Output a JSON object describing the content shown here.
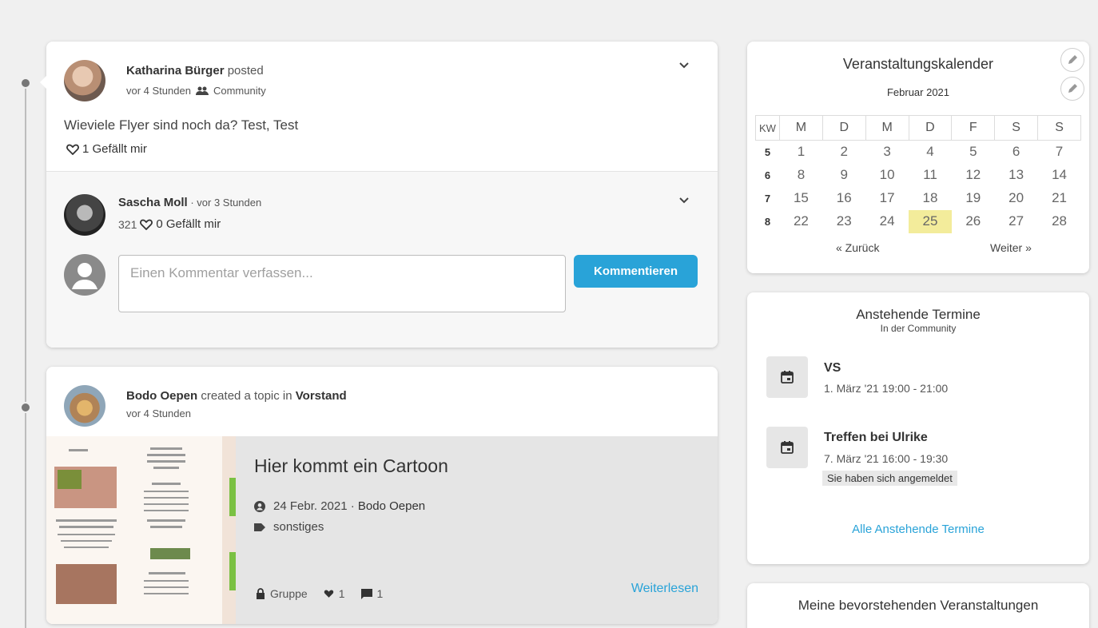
{
  "post1": {
    "author": "Katharina Bürger",
    "action": "posted",
    "time": "vor 4 Stunden",
    "audience": "Community",
    "text": "Wieviele Flyer sind noch da? Test, Test",
    "likes": "1 Gefällt mir",
    "comment": {
      "author": "Sascha Moll",
      "time": "· vor 3 Stunden",
      "number": "321",
      "likes": "0 Gefällt mir"
    },
    "comment_placeholder": "Einen Kommentar verfassen...",
    "comment_button": "Kommentieren"
  },
  "post2": {
    "author": "Bodo Oepen",
    "action": "created a topic in",
    "group": "Vorstand",
    "time": "vor 4 Stunden",
    "topic_title": "Hier kommt ein Cartoon",
    "topic_date": "24 Febr. 2021 ·",
    "topic_author": "Bodo Oepen",
    "topic_tag": "sonstiges",
    "visibility": "Gruppe",
    "likes": "1",
    "comments": "1",
    "read_more": "Weiterlesen"
  },
  "calendar": {
    "title": "Veranstaltungskalender",
    "month": "Februar 2021",
    "kw_label": "KW",
    "weekdays": [
      "M",
      "D",
      "M",
      "D",
      "F",
      "S",
      "S"
    ],
    "weeks": [
      {
        "kw": "5",
        "days": [
          "1",
          "2",
          "3",
          "4",
          "5",
          "6",
          "7"
        ]
      },
      {
        "kw": "6",
        "days": [
          "8",
          "9",
          "10",
          "11",
          "12",
          "13",
          "14"
        ]
      },
      {
        "kw": "7",
        "days": [
          "15",
          "16",
          "17",
          "18",
          "19",
          "20",
          "21"
        ]
      },
      {
        "kw": "8",
        "days": [
          "22",
          "23",
          "24",
          "25",
          "26",
          "27",
          "28"
        ]
      }
    ],
    "today": "25",
    "prev": "« Zurück",
    "next": "Weiter »"
  },
  "upcoming": {
    "title": "Anstehende Termine",
    "subtitle": "In der Community",
    "events": [
      {
        "title": "VS",
        "time": "1. März '21 19:00 - 21:00"
      },
      {
        "title": "Treffen bei Ulrike",
        "time": "7. März '21 16:00 - 19:30",
        "badge": "Sie haben sich angemeldet"
      }
    ],
    "all_link": "Alle Anstehende Termine"
  },
  "my_events": {
    "title": "Meine bevorstehenden Veranstaltungen"
  },
  "colors": {
    "accent": "#29a3d8",
    "today_highlight": "#f3ec9b"
  }
}
